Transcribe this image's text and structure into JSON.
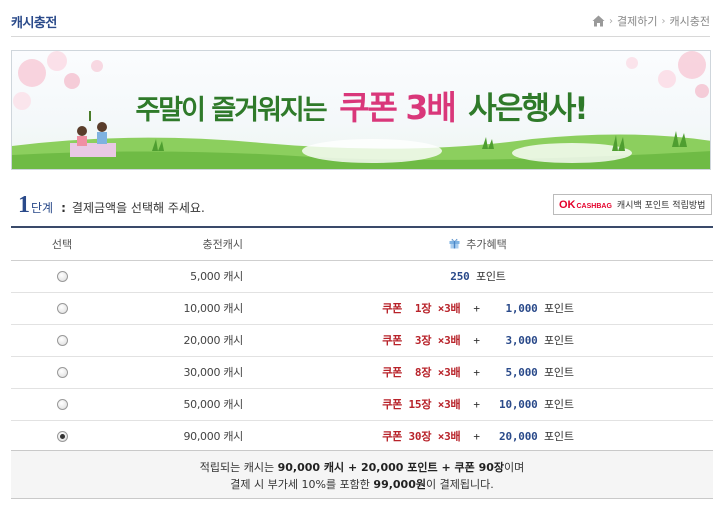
{
  "header": {
    "title": "캐시충전",
    "breadcrumb": [
      "결제하기",
      "캐시충전"
    ]
  },
  "banner": {
    "text_1a": "주말이",
    "text_1b": " 즐거워지는",
    "text_2": "쿠폰 3배",
    "text_3": "사은행사!"
  },
  "step": {
    "number": "1",
    "word": "단계",
    "colon": ":",
    "description": "결제금액을 선택해 주세요."
  },
  "ok_cashbag": {
    "logo_ok": "OK",
    "logo_cashbag": "CASHBAG",
    "label": "캐시백 포인트 적립방법"
  },
  "table": {
    "headers": {
      "select": "선택",
      "amount": "충전캐시",
      "benefit": "추가혜택"
    },
    "rows": [
      {
        "amount": "5,000 캐시",
        "checked": false,
        "points_only": true,
        "points": "250",
        "points_label": " 포인트"
      },
      {
        "amount": "10,000 캐시",
        "checked": false,
        "coupon": "쿠폰  1장 ×3배",
        "plus": "  +   ",
        "points": " 1,000",
        "points_label": " 포인트"
      },
      {
        "amount": "20,000 캐시",
        "checked": false,
        "coupon": "쿠폰  3장 ×3배",
        "plus": "  +   ",
        "points": " 3,000",
        "points_label": " 포인트"
      },
      {
        "amount": "30,000 캐시",
        "checked": false,
        "coupon": "쿠폰  8장 ×3배",
        "plus": "  +   ",
        "points": " 5,000",
        "points_label": " 포인트"
      },
      {
        "amount": "50,000 캐시",
        "checked": false,
        "coupon": "쿠폰 15장 ×3배",
        "plus": "  +   ",
        "points": "10,000",
        "points_label": " 포인트"
      },
      {
        "amount": "90,000 캐시",
        "checked": true,
        "coupon": "쿠폰 30장 ×3배",
        "plus": "  +   ",
        "points": "20,000",
        "points_label": " 포인트"
      }
    ]
  },
  "summary": {
    "l1_a": "적립되는 캐시는 ",
    "l1_b": "90,000 캐시 + 20,000 포인트 + 쿠폰 90장",
    "l1_c": "이며",
    "l2_a": "결제 시 부가세 10%를 포함한 ",
    "l2_b": "99,000원",
    "l2_c": "이 결제됩니다."
  }
}
